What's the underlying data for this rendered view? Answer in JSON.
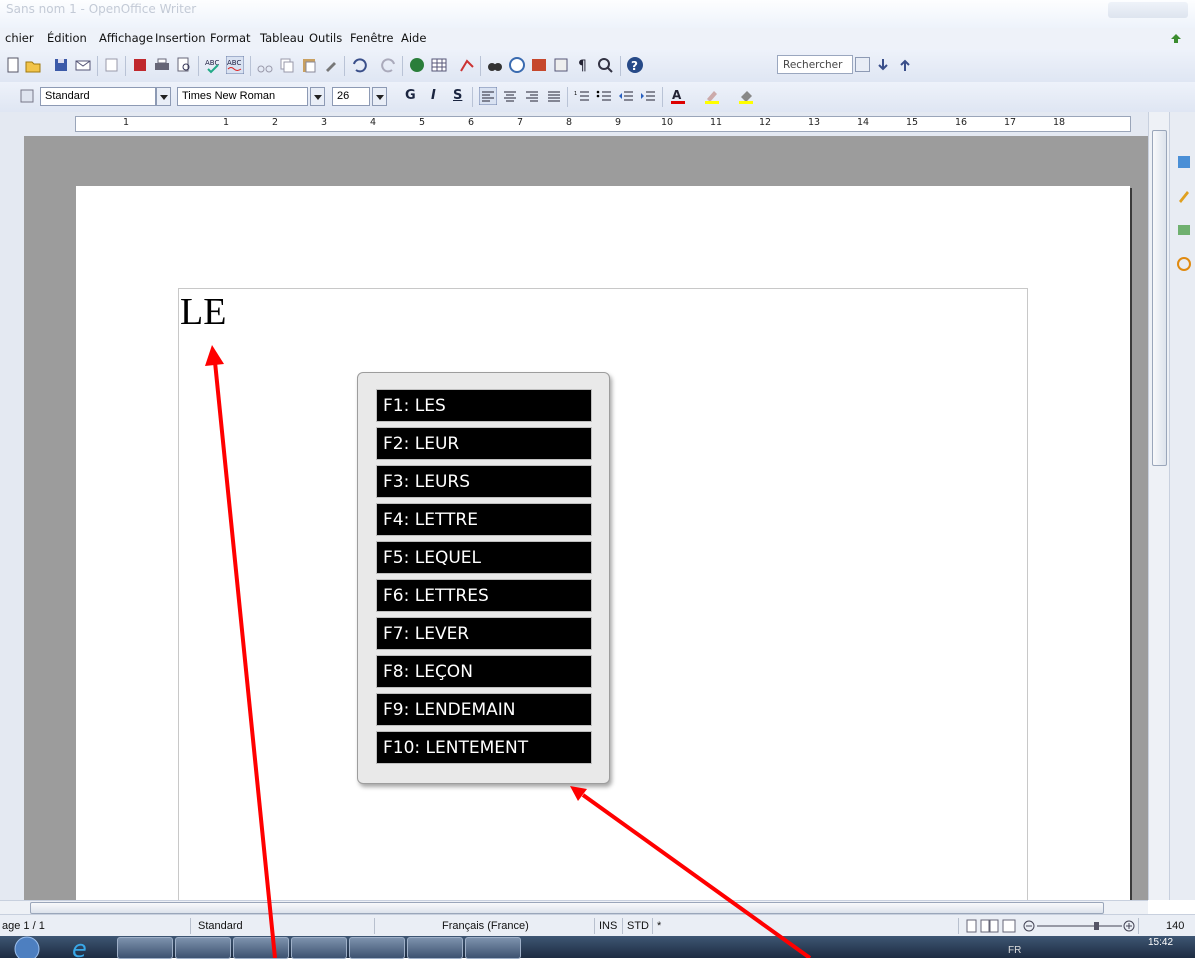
{
  "window": {
    "title": "Sans nom 1 - OpenOffice Writer"
  },
  "menu": {
    "items": [
      "chier",
      "Édition",
      "Affichage",
      "Insertion",
      "Format",
      "Tableau",
      "Outils",
      "Fenêtre",
      "Aide"
    ]
  },
  "toolbar": {
    "search_placeholder": "Rechercher"
  },
  "format_bar": {
    "style": "Standard",
    "font": "Times New Roman",
    "size": "26",
    "bold": "G",
    "italic": "I",
    "underline": "S"
  },
  "ruler": {
    "labels": [
      "1",
      "1",
      "2",
      "3",
      "4",
      "5",
      "6",
      "7",
      "8",
      "9",
      "10",
      "11",
      "12",
      "13",
      "14",
      "15",
      "16",
      "17",
      "18"
    ]
  },
  "document": {
    "text": "LE"
  },
  "suggestions": [
    "F1: LES",
    "F2: LEUR",
    "F3: LEURS",
    "F4: LETTRE",
    "F5: LEQUEL",
    "F6: LETTRES",
    "F7: LEVER",
    "F8: LEÇON",
    "F9: LENDEMAIN",
    "F10: LENTEMENT"
  ],
  "status": {
    "page": "age 1 / 1",
    "style": "Standard",
    "language": "Français (France)",
    "mode_ins": "INS",
    "mode_std": "STD",
    "modified": "*",
    "zoom": "140"
  },
  "taskbar": {
    "lang": "FR",
    "clock": "15:42"
  },
  "colors": {
    "arrow": "#ff0000",
    "popup_item_bg": "#000000",
    "popup_item_text": "#ffffff"
  }
}
